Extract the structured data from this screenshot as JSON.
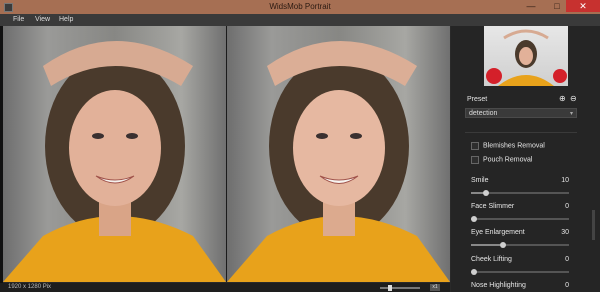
{
  "window": {
    "title": "WidsMob Portrait",
    "minimize": "—",
    "maximize": "□",
    "close": "✕"
  },
  "menu": {
    "items": [
      "File",
      "View",
      "Help"
    ]
  },
  "status": {
    "image_size": "1920 x 1280 Pix",
    "zoom_fraction": 0.2,
    "zoom_button": "x1"
  },
  "preset": {
    "label": "Preset",
    "add_icon": "⊕",
    "remove_icon": "⊖",
    "selected": "detection",
    "chevron": "▾"
  },
  "options": [
    {
      "label": "Blemishes Removal",
      "checked": false
    },
    {
      "label": "Pouch Removal",
      "checked": false
    }
  ],
  "sliders": [
    {
      "label": "Smile",
      "value": "10",
      "fraction": 0.12
    },
    {
      "label": "Face Slimmer",
      "value": "0",
      "fraction": 0.0
    },
    {
      "label": "Eye Enlargement",
      "value": "30",
      "fraction": 0.3
    },
    {
      "label": "Cheek Lifting",
      "value": "0",
      "fraction": 0.0
    },
    {
      "label": "Nose Highlighting",
      "value": "0",
      "fraction": 0.0
    }
  ],
  "colors": {
    "titlebar": "#a66f53",
    "close": "#c7312f",
    "shirt": "#e8a21b",
    "panel": "#252525"
  }
}
